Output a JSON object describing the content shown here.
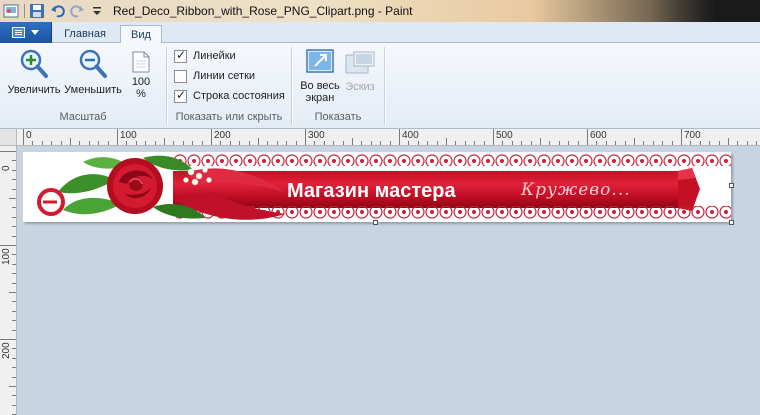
{
  "window": {
    "title": "Red_Deco_Ribbon_with_Rose_PNG_Clipart.png - Paint",
    "quick_access": [
      "app-icon",
      "save-icon",
      "undo-icon",
      "redo-icon",
      "customize-arrow-icon"
    ]
  },
  "tabs": {
    "home": "Главная",
    "view": "Вид",
    "active": "view"
  },
  "ribbon": {
    "zoom_group": {
      "label": "Масштаб",
      "zoom_in": "Увеличить",
      "zoom_out": "Уменьшить",
      "hundred_line1": "100",
      "hundred_line2": "%"
    },
    "show_group": {
      "label": "Показать или скрыть",
      "rulers": "Линейки",
      "rulers_checked": true,
      "gridlines": "Линии сетки",
      "gridlines_checked": false,
      "status_bar": "Строка состояния",
      "status_bar_checked": true
    },
    "display_group": {
      "label": "Показать",
      "full_screen_line1": "Во весь",
      "full_screen_line2": "экран",
      "thumbnail": "Эскиз",
      "thumbnail_enabled": false
    }
  },
  "rulers": {
    "horizontal_labels": [
      "0",
      "100",
      "200",
      "300",
      "400",
      "500",
      "600",
      "700"
    ],
    "vertical_labels": [
      "0",
      "100",
      "200"
    ]
  },
  "image": {
    "shop_name": "Магазин мастера",
    "tagline": "Кружево...",
    "colors": {
      "ribbon_red": "#d0182f",
      "lace_red": "#c8203a",
      "leaf_green": "#3d8f2a"
    }
  },
  "colors": {
    "workspace": "#c9d4e2",
    "ribbon_bg": "#f5f8fc",
    "file_button": "#2563b4",
    "tab_text": "#1e395b"
  }
}
